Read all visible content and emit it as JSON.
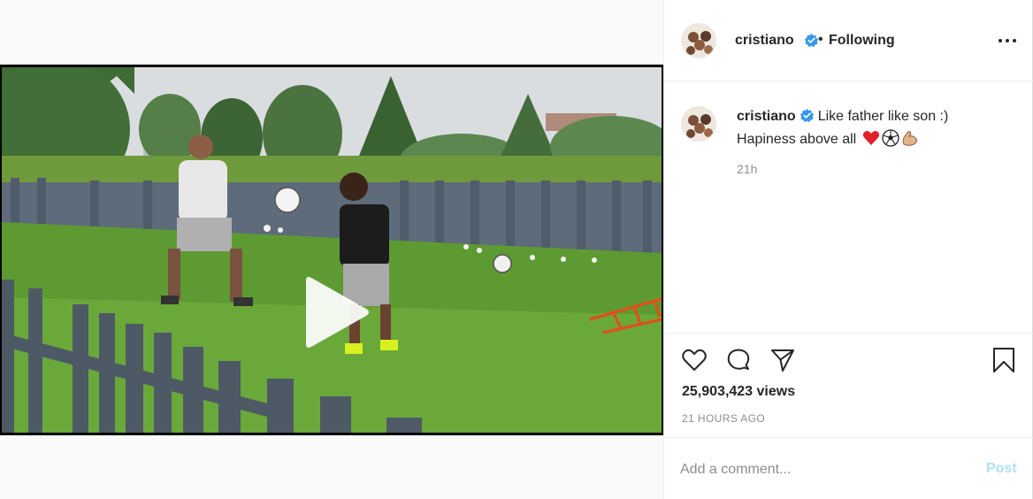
{
  "header": {
    "username": "cristiano",
    "separator": "•",
    "follow_status": "Following"
  },
  "caption": {
    "username": "cristiano",
    "text_line1": "Like father like son :)",
    "text_line2": "Hapiness above all",
    "emojis": [
      "red-heart-emoji",
      "soccer-ball-emoji",
      "flexed-biceps-emoji"
    ],
    "relative_time": "21h"
  },
  "stats": {
    "views": "25,903,423 views",
    "posted": "21 HOURS AGO"
  },
  "comment": {
    "placeholder": "Add a comment...",
    "post_label": "Post"
  },
  "colors": {
    "verified_badge": "#3897f0",
    "post_button": "#b2dffc",
    "secondary_text": "#8e8e8e"
  },
  "icons": [
    "more-options-icon",
    "verified-icon",
    "play-icon",
    "heart-icon",
    "comment-icon",
    "share-icon",
    "bookmark-icon"
  ]
}
